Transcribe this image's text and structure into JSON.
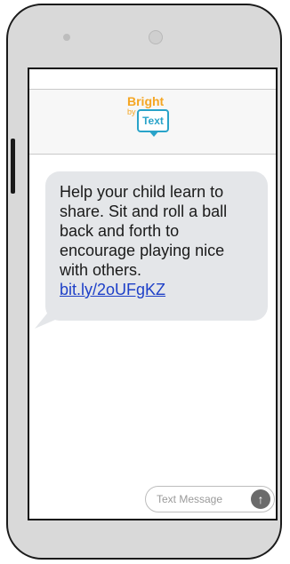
{
  "header": {
    "logo_bright": "Bright",
    "logo_by": "by",
    "logo_text": "Text",
    "logo_colors": {
      "bright": "#f5a623",
      "text": "#29a3c9"
    }
  },
  "message": {
    "body": "Help your child learn to share. Sit and roll a ball back and forth to encourage playing nice with others.",
    "link_text": "bit.ly/2oUFgKZ",
    "bubble_color": "#e4e6e9",
    "link_color": "#1e40c8"
  },
  "composer": {
    "placeholder": "Text Message",
    "send_icon": "arrow-up-icon"
  }
}
